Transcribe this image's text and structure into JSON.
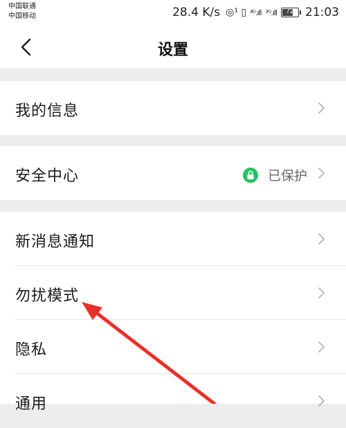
{
  "status_bar": {
    "carrier_1": "中国联通",
    "carrier_2": "中国移动",
    "net_speed": "28.4 K/s",
    "icon_glyphs": "◎¹ ▯",
    "signal_1": "⁴ᴳ.ıll",
    "signal_2": "²ᴳ.ıll",
    "battery_level": "72",
    "battery_fraction": 0.72,
    "time": "21:03"
  },
  "nav": {
    "back_icon": "chevron-left-icon",
    "title": "设置"
  },
  "groups": [
    {
      "items": [
        {
          "label": "我的信息",
          "icon": "chevron-right-icon"
        }
      ]
    },
    {
      "items": [
        {
          "label": "安全中心",
          "status_icon": "lock-icon",
          "status_color": "#21c460",
          "status_text": "已保护",
          "icon": "chevron-right-icon"
        }
      ]
    },
    {
      "items": [
        {
          "label": "新消息通知",
          "icon": "chevron-right-icon"
        },
        {
          "label": "勿扰模式",
          "icon": "chevron-right-icon"
        },
        {
          "label": "隐私",
          "icon": "chevron-right-icon"
        },
        {
          "label": "通用",
          "icon": "chevron-right-icon"
        }
      ]
    }
  ],
  "annotation": {
    "type": "arrow",
    "color": "#e8302a"
  }
}
